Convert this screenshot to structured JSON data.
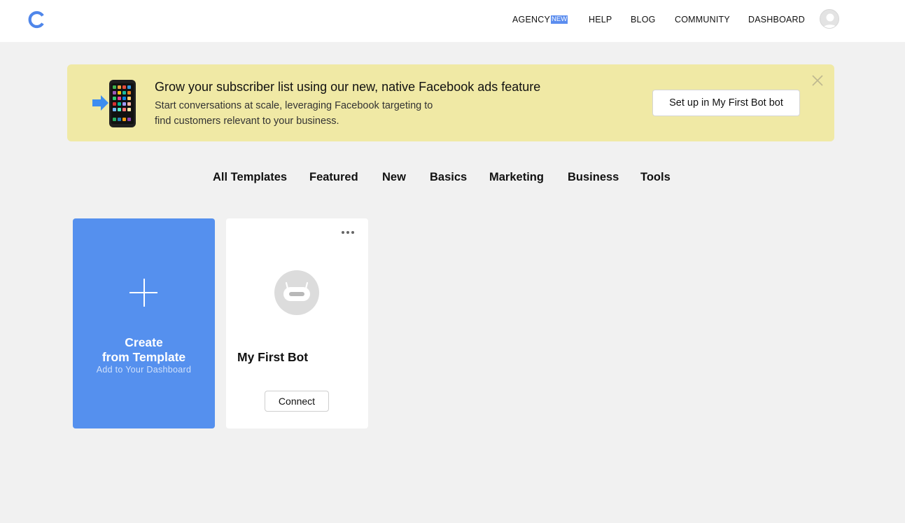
{
  "header": {
    "nav": [
      {
        "label": "AGENCY",
        "badge": "NEW"
      },
      {
        "label": "HELP"
      },
      {
        "label": "BLOG"
      },
      {
        "label": "COMMUNITY"
      },
      {
        "label": "DASHBOARD"
      }
    ],
    "logo_icon": "c-logo-icon",
    "avatar_icon": "user-avatar-icon"
  },
  "banner": {
    "title": "Grow your subscriber list using our new, native Facebook ads feature",
    "text": "Start conversations at scale, leveraging Facebook targeting to find customers relevant to your business.",
    "button_label": "Set up in My First Bot bot",
    "icon": "phone-arrow-icon",
    "close_icon": "close-icon",
    "background": "#f0e9a5"
  },
  "tabs": [
    "All Templates",
    "Featured",
    "New",
    "Basics",
    "Marketing",
    "Business",
    "Tools"
  ],
  "cards": {
    "create": {
      "title_line1": "Create",
      "title_line2": "from Template",
      "subtitle": "Add to Your Dashboard",
      "color": "#5590ee"
    },
    "bot": {
      "name": "My First Bot",
      "connect_label": "Connect",
      "avatar_icon": "robot-icon",
      "menu_icon": "more-icon"
    }
  }
}
